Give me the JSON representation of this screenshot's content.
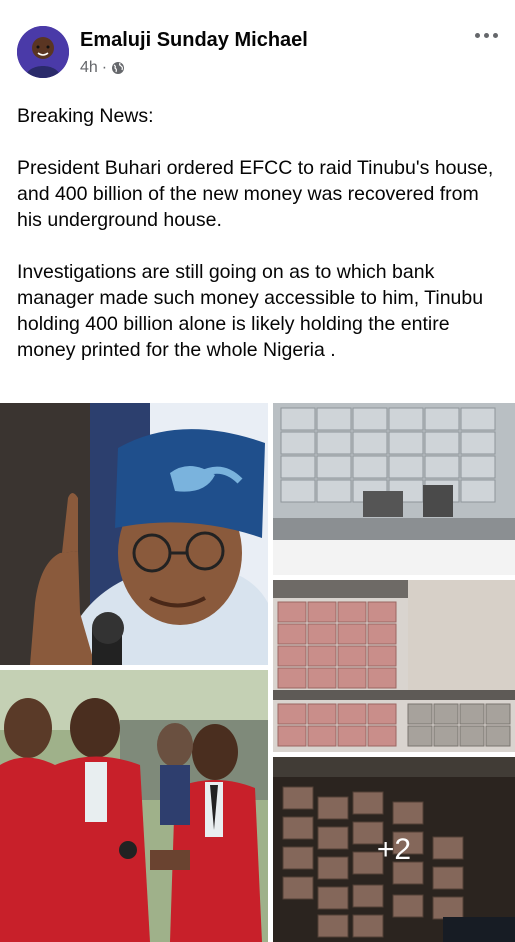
{
  "post": {
    "author": "Emaluji Sunday Michael",
    "time": "4h",
    "separator": "·",
    "audience_icon": "globe-icon",
    "more_icon": "more-horizontal-icon",
    "paragraphs": [
      "Breaking News:",
      "President Buhari ordered EFCC to raid Tinubu's house, and 400 billion of the new money was recovered from his underground house.",
      "Investigations are still going on as to which bank manager made such money accessible to him, Tinubu holding 400 billion alone is likely holding the entire money printed for the whole Nigeria ."
    ]
  },
  "gallery": {
    "more_count_label": "+2",
    "photos": [
      {
        "subject": "politician-in-blue-cap"
      },
      {
        "subject": "stacks-of-currency-on-shelf"
      },
      {
        "subject": "efcc-officers-in-red-vests"
      },
      {
        "subject": "pink-currency-bundles-on-shelves"
      },
      {
        "subject": "currency-bundles-on-floor"
      }
    ]
  },
  "colors": {
    "text_primary": "#050505",
    "text_secondary": "#65676b",
    "efcc_red": "#c8202a",
    "cap_blue": "#1f4f8c"
  }
}
